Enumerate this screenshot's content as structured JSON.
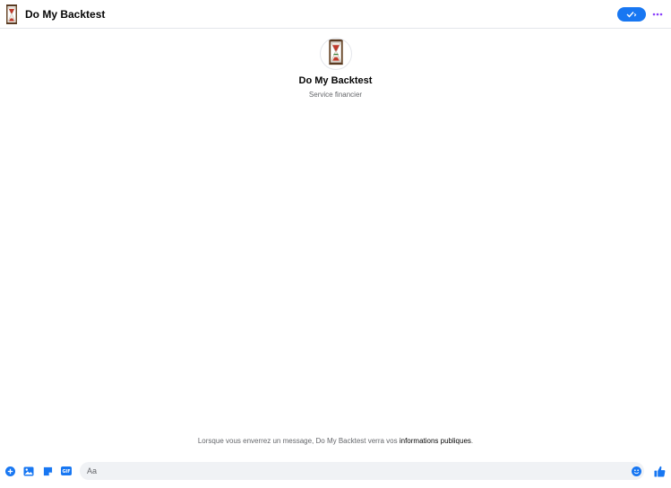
{
  "header": {
    "title": "Do My Backtest",
    "avatar_icon": "hourglass-icon",
    "verify_icon": "check-icon",
    "more_icon": "more-dots-icon"
  },
  "profile": {
    "name": "Do My Backtest",
    "category": "Service financier",
    "avatar_icon": "hourglass-icon"
  },
  "notice": {
    "text": "Lorsque vous enverrez un message, Do My Backtest verra vos ",
    "link": "informations publiques",
    "suffix": "."
  },
  "composer": {
    "placeholder": "Aa",
    "tools": [
      "plus-icon",
      "photo-icon",
      "sticker-icon",
      "gif-icon"
    ],
    "emoji_icon": "emoji-icon",
    "like_icon": "thumbs-up-icon"
  },
  "colors": {
    "accent": "#1877f2",
    "text": "#050505",
    "secondary_text": "#65676b",
    "input_bg": "#f0f2f5"
  }
}
